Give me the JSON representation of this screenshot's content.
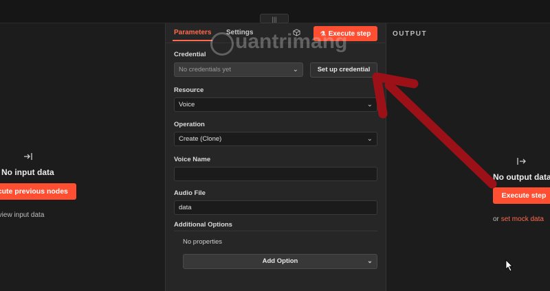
{
  "topbar": {
    "handle_glyph": "|||"
  },
  "input_pane": {
    "icon": "arrow-to-right-icon",
    "title": "No input data",
    "execute_button": "Execute previous nodes",
    "hint": "or view input data"
  },
  "parameters_panel": {
    "tabs": [
      {
        "label": "Parameters",
        "active": true
      },
      {
        "label": "Settings",
        "active": false
      }
    ],
    "execute_button": "Execute step",
    "credential": {
      "label": "Credential",
      "placeholder": "No credentials yet",
      "setup_button": "Set up credential"
    },
    "resource": {
      "label": "Resource",
      "value": "Voice"
    },
    "operation": {
      "label": "Operation",
      "value": "Create (Clone)"
    },
    "voice_name": {
      "label": "Voice Name",
      "value": ""
    },
    "audio_file": {
      "label": "Audio File",
      "value": "data"
    },
    "additional_options": {
      "label": "Additional Options",
      "empty_text": "No properties",
      "add_button": "Add Option"
    }
  },
  "output_pane": {
    "header": "OUTPUT",
    "icon": "arrow-from-right-icon",
    "title": "No output data",
    "execute_button": "Execute step",
    "hint_prefix": "or",
    "hint_link": "set mock data"
  },
  "watermark": {
    "text": "uantrimang"
  },
  "colors": {
    "accent": "#ff4f33",
    "annotation_arrow": "#9b1117",
    "panel_bg": "#262626",
    "pane_bg": "#1c1c1c"
  }
}
